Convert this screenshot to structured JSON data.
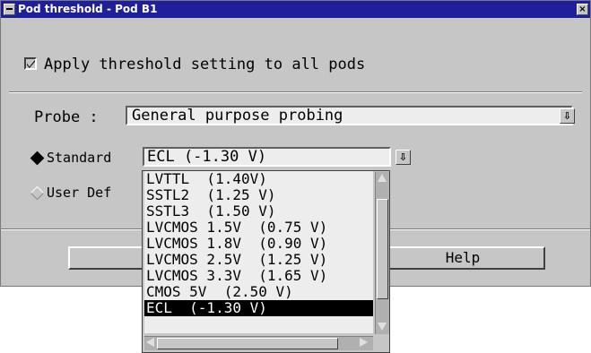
{
  "window": {
    "title": "Pod threshold - Pod B1",
    "close_glyph": "×",
    "menu_icon": "system-menu-icon"
  },
  "apply_all": {
    "label": "Apply threshold setting to all pods",
    "checked": true
  },
  "probe": {
    "label": "Probe :",
    "value": "General purpose probing",
    "dropdown_glyph": "⇩"
  },
  "standard": {
    "label": "Standard",
    "selected": true,
    "value": "ECL  (-1.30 V)",
    "dropdown_glyph": "⇩"
  },
  "user_defined": {
    "label": "User Def",
    "selected": false
  },
  "standard_list": {
    "items": [
      "LVTTL  (1.40V)",
      "SSTL2  (1.25 V)",
      "SSTL3  (1.50 V)",
      "LVCMOS 1.5V  (0.75 V)",
      "LVCMOS 1.8V  (0.90 V)",
      "LVCMOS 2.5V  (1.25 V)",
      "LVCMOS 3.3V  (1.65 V)",
      "CMOS 5V  (2.50 V)",
      "ECL  (-1.30 V)"
    ],
    "selected_index": 8
  },
  "buttons": {
    "help": "Help"
  },
  "colors": {
    "title_bar": "#1f1f9b",
    "window_bg": "#c6c6c6",
    "field_bg": "#ededed",
    "selection": "#000000"
  }
}
